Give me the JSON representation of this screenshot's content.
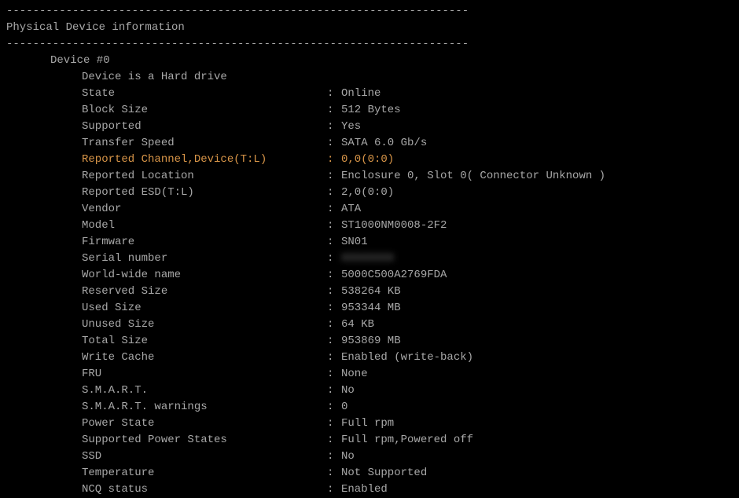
{
  "separator_top": "----------------------------------------------------------------------",
  "section_title": "Physical Device information",
  "separator_mid": "----------------------------------------------------------------------",
  "device_header": "Device #0",
  "device_desc": "Device is a Hard drive",
  "rows": [
    {
      "label": "State",
      "value": "Online",
      "highlight": false
    },
    {
      "label": "Block Size",
      "value": "512 Bytes",
      "highlight": false
    },
    {
      "label": "Supported",
      "value": "Yes",
      "highlight": false
    },
    {
      "label": "Transfer Speed",
      "value": "SATA 6.0 Gb/s",
      "highlight": false
    },
    {
      "label": "Reported Channel,Device(T:L)",
      "value": "0,0(0:0)",
      "highlight": true
    },
    {
      "label": "Reported Location",
      "value": "Enclosure 0, Slot 0( Connector Unknown )",
      "highlight": false
    },
    {
      "label": "Reported ESD(T:L)",
      "value": "2,0(0:0)",
      "highlight": false
    },
    {
      "label": "Vendor",
      "value": "ATA",
      "highlight": false
    },
    {
      "label": "Model",
      "value": "ST1000NM0008-2F2",
      "highlight": false
    },
    {
      "label": "Firmware",
      "value": "SN01",
      "highlight": false
    },
    {
      "label": "Serial number",
      "value": "XXXXXXXX",
      "highlight": false,
      "blurred": true
    },
    {
      "label": "World-wide name",
      "value": "5000C500A2769FDA",
      "highlight": false
    },
    {
      "label": "Reserved Size",
      "value": "538264 KB",
      "highlight": false
    },
    {
      "label": "Used Size",
      "value": "953344 MB",
      "highlight": false
    },
    {
      "label": "Unused Size",
      "value": "64 KB",
      "highlight": false
    },
    {
      "label": "Total Size",
      "value": "953869 MB",
      "highlight": false
    },
    {
      "label": "Write Cache",
      "value": "Enabled (write-back)",
      "highlight": false
    },
    {
      "label": "FRU",
      "value": "None",
      "highlight": false
    },
    {
      "label": "S.M.A.R.T.",
      "value": "No",
      "highlight": false
    },
    {
      "label": "S.M.A.R.T. warnings",
      "value": "0",
      "highlight": false
    },
    {
      "label": "Power State",
      "value": "Full rpm",
      "highlight": false
    },
    {
      "label": "Supported Power States",
      "value": "Full rpm,Powered off",
      "highlight": false
    },
    {
      "label": "SSD",
      "value": "No",
      "highlight": false
    },
    {
      "label": "Temperature",
      "value": "Not Supported",
      "highlight": false
    },
    {
      "label": "NCQ status",
      "value": "Enabled",
      "highlight": false
    }
  ],
  "colon": ":"
}
